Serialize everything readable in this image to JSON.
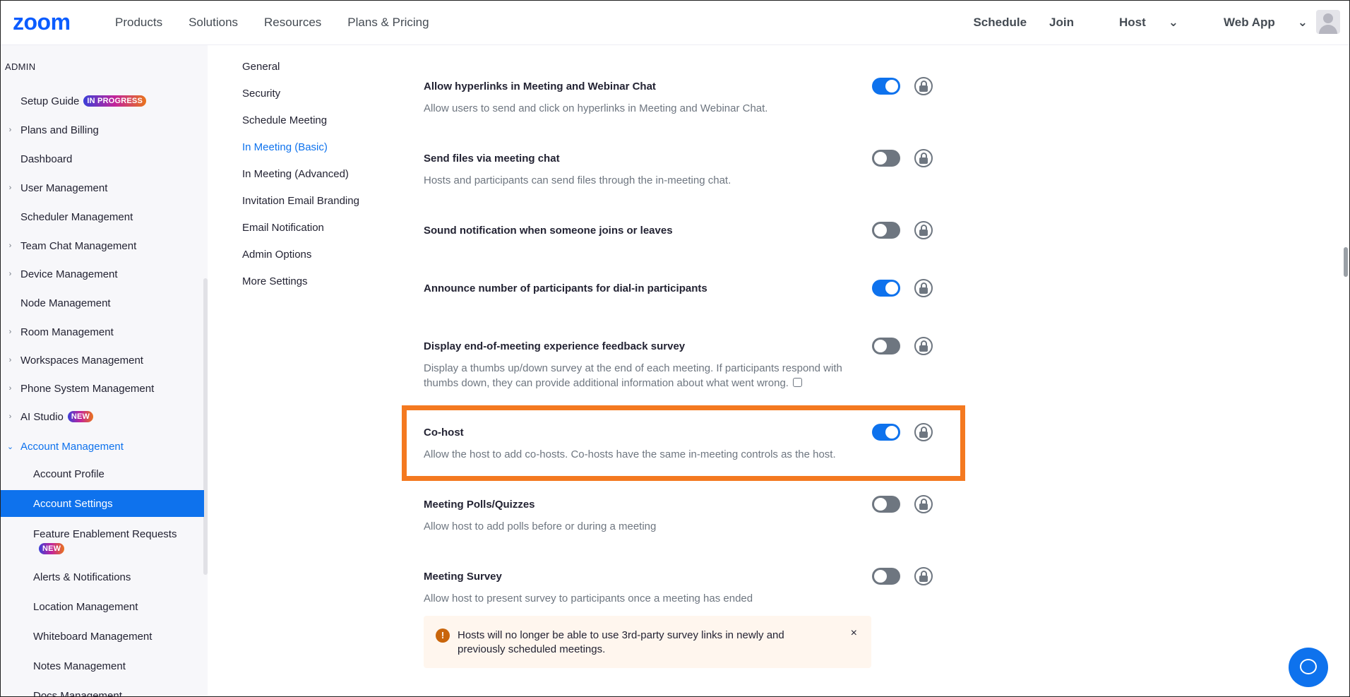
{
  "topnav": {
    "logo": "zoom",
    "links": [
      "Products",
      "Solutions",
      "Resources",
      "Plans & Pricing"
    ],
    "right": {
      "schedule": "Schedule",
      "join": "Join",
      "host": "Host",
      "web_app": "Web App"
    }
  },
  "sidebar": {
    "section": "ADMIN",
    "items": [
      {
        "label": "Setup Guide",
        "badge": "IN PROGRESS"
      },
      {
        "label": "Plans and Billing"
      },
      {
        "label": "Dashboard"
      },
      {
        "label": "User Management"
      },
      {
        "label": "Scheduler Management"
      },
      {
        "label": "Team Chat Management"
      },
      {
        "label": "Device Management"
      },
      {
        "label": "Node Management"
      },
      {
        "label": "Room Management"
      },
      {
        "label": "Workspaces Management"
      },
      {
        "label": "Phone System Management"
      },
      {
        "label": "AI Studio",
        "badge": "NEW"
      },
      {
        "label": "Account Management"
      },
      {
        "label": "Account Profile"
      },
      {
        "label": "Account Settings"
      },
      {
        "label": "Feature Enablement Requests",
        "badge": "NEW"
      },
      {
        "label": "Alerts & Notifications"
      },
      {
        "label": "Location Management"
      },
      {
        "label": "Whiteboard Management"
      },
      {
        "label": "Notes Management"
      },
      {
        "label": "Docs Management"
      }
    ]
  },
  "submenu": [
    "General",
    "Security",
    "Schedule Meeting",
    "In Meeting (Basic)",
    "In Meeting (Advanced)",
    "Invitation Email Branding",
    "Email Notification",
    "Admin Options",
    "More Settings"
  ],
  "settings": [
    {
      "title": "Allow hyperlinks in Meeting and Webinar Chat",
      "desc": "Allow users to send and click on hyperlinks in Meeting and Webinar Chat.",
      "on": true
    },
    {
      "title": "Send files via meeting chat",
      "desc": "Hosts and participants can send files through the in-meeting chat.",
      "on": false
    },
    {
      "title": "Sound notification when someone joins or leaves",
      "desc": "",
      "on": false
    },
    {
      "title": "Announce number of participants for dial-in participants",
      "desc": "",
      "on": true
    },
    {
      "title": "Display end-of-meeting experience feedback survey",
      "desc": "Display a thumbs up/down survey at the end of each meeting. If participants respond with thumbs down, they can provide additional information about what went wrong.",
      "on": false
    },
    {
      "title": "Co-host",
      "desc": "Allow the host to add co-hosts. Co-hosts have the same in-meeting controls as the host.",
      "on": true
    },
    {
      "title": "Meeting Polls/Quizzes",
      "desc": "Allow host to add polls before or during a meeting",
      "on": false
    },
    {
      "title": "Meeting Survey",
      "desc": "Allow host to present survey to participants once a meeting has ended",
      "on": false
    }
  ],
  "notice": {
    "text": "Hosts will no longer be able to use 3rd-party survey links in newly and previously scheduled meetings.",
    "icon": "!",
    "close": "×"
  },
  "colors": {
    "accent": "#0e72ed",
    "highlight": "#f47920",
    "toggle_off": "#6e7680"
  }
}
